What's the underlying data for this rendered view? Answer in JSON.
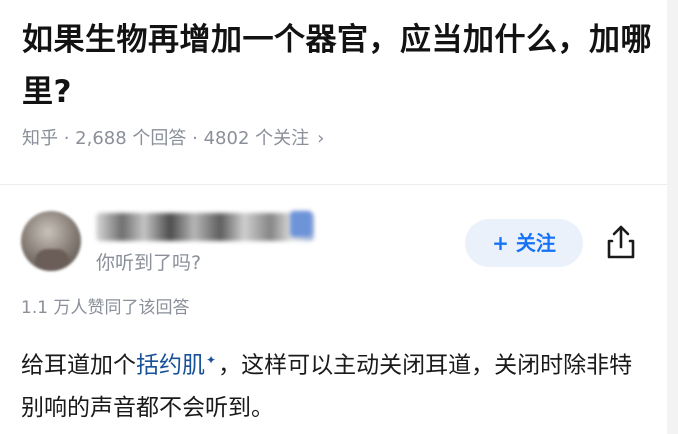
{
  "question": {
    "title": "如果生物再增加一个器官，应当加什么，加哪里?",
    "meta": "知乎 · 2,688 个回答 · 4802 个关注",
    "chevron_icon": "chevron-right-icon"
  },
  "answer": {
    "author": {
      "bio": "你听到了吗?"
    },
    "follow_label": "+ 关注",
    "share_icon": "share-icon",
    "votes": "1.1 万人赞同了该回答",
    "content": {
      "before_link": "给耳道加个",
      "link": "括约肌",
      "link_mark": "✦",
      "after_link": "，这样可以主动关闭耳道，关闭时除非特别响的声音都不会听到。"
    }
  },
  "colors": {
    "accent": "#1772f6",
    "link": "#175199",
    "meta_text": "#8a8f99",
    "follow_bg": "#ebf1fb"
  }
}
